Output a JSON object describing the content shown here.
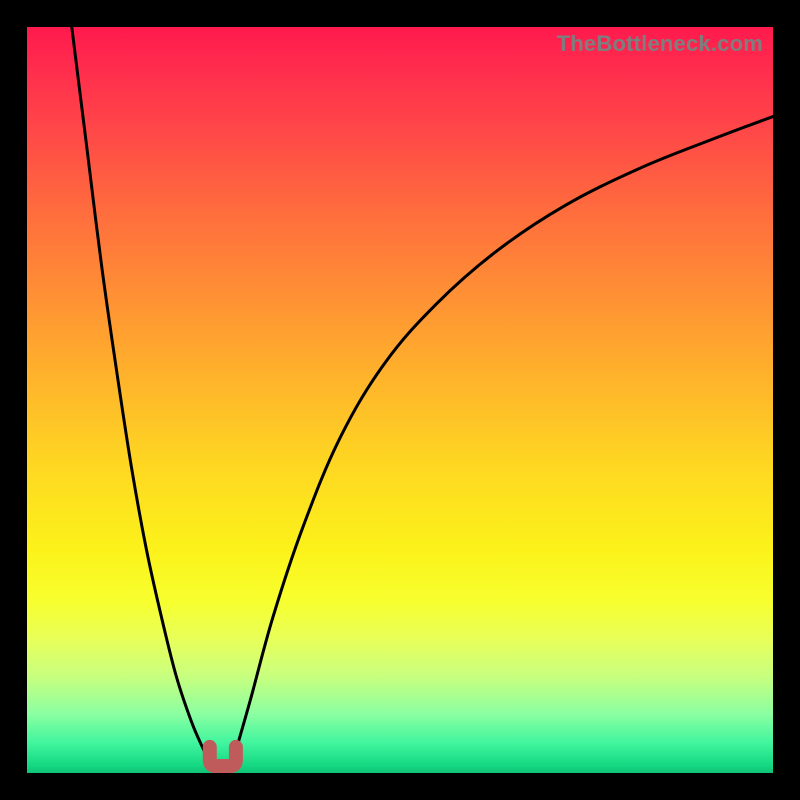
{
  "attribution": "TheBottleneck.com",
  "colors": {
    "page_bg": "#000000",
    "curve": "#000000",
    "valley_marker": "#c05b5b",
    "gradient_top": "#ff1a4d",
    "gradient_bottom": "#0fc278"
  },
  "chart_data": {
    "type": "line",
    "title": "",
    "xlabel": "",
    "ylabel": "",
    "xlim": [
      0,
      100
    ],
    "ylim": [
      0,
      100
    ],
    "grid": false,
    "legend": false,
    "series": [
      {
        "name": "left-curve",
        "x": [
          6.0,
          8.0,
          10.0,
          12.0,
          14.0,
          16.0,
          18.0,
          20.0,
          22.0,
          23.5,
          24.5
        ],
        "values": [
          100.0,
          84.0,
          68.0,
          54.0,
          41.0,
          30.0,
          21.0,
          13.0,
          7.0,
          3.5,
          1.5
        ]
      },
      {
        "name": "right-curve",
        "x": [
          28.0,
          30.0,
          33.0,
          37.0,
          42.0,
          48.0,
          55.0,
          63.0,
          72.0,
          82.0,
          92.0,
          100.0
        ],
        "values": [
          3.0,
          10.0,
          21.0,
          33.0,
          45.0,
          55.0,
          63.0,
          70.0,
          76.0,
          81.0,
          85.0,
          88.0
        ]
      }
    ],
    "valley_marker": {
      "name": "optimal-point",
      "shape": "U",
      "x_range": [
        24.5,
        28.0
      ],
      "y_range": [
        0.0,
        3.5
      ]
    }
  }
}
